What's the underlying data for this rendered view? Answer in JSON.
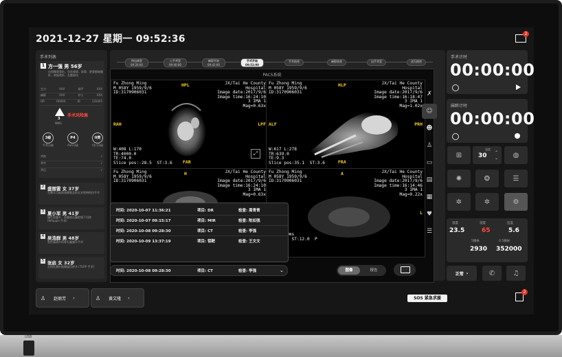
{
  "header": {
    "datetime": "2021-12-27  星期一  09:52:36",
    "mail_badge": "2"
  },
  "left_panel": {
    "title": "手术列表",
    "current": {
      "index": "1",
      "name": "方一强 男 56岁",
      "desc": "右侧踝骨骨折，包含腓骨，距骨、胫骨都被酸折，跗跖骨折，右膝部伤",
      "rows": [
        [
          "主刀",
          "XXX",
          "助手",
          "XXX"
        ],
        [
          "麻醉",
          "XXX",
          "护士",
          "XXX"
        ],
        [
          "OR",
          "OR004",
          "ID",
          "131025"
        ]
      ],
      "risk_label": "手术风险高",
      "risk_sub": "NNIS",
      "risk_value": "3",
      "stats": [
        [
          "3级",
          "手术分级"
        ],
        [
          "P4",
          "ASA分级"
        ],
        [
          "II类",
          "切口分级"
        ]
      ],
      "checks": [
        [
          "术前",
          "√"
        ],
        [
          "术中",
          "√"
        ],
        [
          "术后",
          "√"
        ]
      ]
    },
    "queue": [
      {
        "index": "2",
        "name": "盛丽雷 女 37岁",
        "desc": "左膝半月板前角撕裂及前交叉韧带损伤手术"
      },
      {
        "index": "3",
        "name": "夏小军 男 41岁",
        "desc": "慢性胆囊炎，胆囊结石腹腔镜下切除 (Whipple 手术)"
      },
      {
        "index": "4",
        "name": "吴浩群 男 48岁",
        "desc": "急性阑尾炎伴穿孔腹膜炎手术"
      },
      {
        "index": "5",
        "name": "张启 女 32岁",
        "desc": "右侧乳腺纤维腺瘤切除术 [TURP 手术]"
      }
    ]
  },
  "timeline": [
    {
      "label": "待出病室",
      "time": "09:26:00",
      "active": false
    },
    {
      "label": "入手术室",
      "time": "09:40:00",
      "active": false
    },
    {
      "label": "麻醉开始",
      "time": "09:42:00",
      "active": false
    },
    {
      "label": "手术开始",
      "time": "09:52:00",
      "active": true
    },
    {
      "label": "手术结束",
      "time": "",
      "active": false
    },
    {
      "label": "麻醉结束",
      "time": "",
      "active": false
    },
    {
      "label": "出手术室",
      "time": "",
      "active": false
    },
    {
      "label": "送归病房",
      "time": "",
      "active": false
    }
  ],
  "pacs": {
    "title": "PACS系统",
    "images": [
      {
        "tl": "Fu Zhong Ming\nM 058Y 1959/9/6\nID:3170906031",
        "tr": "JX/Tai He County\nHospital\nImage date:2017/9/6\nImage time:16:24:10\n3 IMA 1\nMag=0.63x",
        "top_label": "HPL",
        "left_label": "RAH",
        "right_label": "LPF",
        "bottom_label": "FAR",
        "bl": "W:408 L:170\nTR:4000.0\nTE:74.0\nSlice pos:-28.5  ST:3.6"
      },
      {
        "tl": "Fu Zhong Ming\nM 058Y 1959/9/6\nID:3170906031",
        "tr": "JX/Tai He County\nHospital\nImage date:2017/9/6\nImage time:16:18:47\n3 IMA 1\nMag=1.02x",
        "top_label": "HLP",
        "left_label": "ALF",
        "right_label": "PRH",
        "bottom_label": "FRA",
        "bl": "W:617 L:278\nTR:639.0\nTE:9.3\nSlice pos:35.1  ST:3.6"
      },
      {
        "tl": "Fu Zhong Ming\nM 058Y 1959/9/6\nID:3170906031",
        "tr": "JX/Tai He County\nHospital\nImage date:2017/9/6\nImage time:16:24:10\n3 IMA 1\nMag=0.63x",
        "top_label": "H",
        "left_label": "",
        "right_label": "",
        "bottom_label": "",
        "bl": ""
      },
      {
        "tl": "Fu Zhong Ming\nM 058Y 1959/9/6\nID:3170906031",
        "tr": "JX/Tai He County\nHospital\nImage date:2017/9/6\nImage time:16:14:46\n3 IMA 1\nMag=0.22x",
        "top_label": "A",
        "left_label": "",
        "right_label": "L",
        "bottom_label": "",
        "bl": "L:1724\n\ne time:9ms\nos:24.0  ST:12.0  P"
      }
    ]
  },
  "popup_rows": [
    {
      "time": "时间: 2020-10-07 11:36:21",
      "item": "项目: DR",
      "check": "检查: 周青青"
    },
    {
      "time": "时间: 2020-10-07 09:15:17",
      "item": "项目: MIR",
      "check": "检查: 陈如强"
    },
    {
      "time": "时间: 2020-10-08 09:28:30",
      "item": "项目: CT",
      "check": "检查: 李强"
    },
    {
      "time": "时间: 2020-10-09 13:37:19",
      "item": "项目: 钼靶",
      "check": "检查: 王文文"
    }
  ],
  "bottom_record": {
    "time": "时间: 2020-10-08 09:28:30",
    "item": "项目: CT",
    "check": "检查: 李强"
  },
  "toggle": {
    "image": "图像",
    "report": "报告"
  },
  "timers": [
    {
      "title": "手术计时",
      "value": "00:00:00"
    },
    {
      "title": "麻醉计时",
      "value": "00:00:00"
    }
  ],
  "temperature": {
    "label": "温度",
    "value": "30"
  },
  "vitals": [
    {
      "label": "温度",
      "value": "23.5",
      "color": "#ffffff"
    },
    {
      "label": "湿度",
      "value": "65",
      "color": "#ff4a3a"
    },
    {
      "label": "压差",
      "value": "5.6",
      "color": "#ffffff"
    },
    {
      "label": "5微米",
      "value": "2930",
      "color": "#ffffff"
    },
    {
      "label": "0.5微米",
      "value": "352000",
      "color": "#ffffff"
    }
  ],
  "status_btn": "正常",
  "sos": "SOS 紧急求援",
  "patients_bottom": [
    "赵丽芳",
    "黄文隆"
  ],
  "bottom_badge": "2"
}
